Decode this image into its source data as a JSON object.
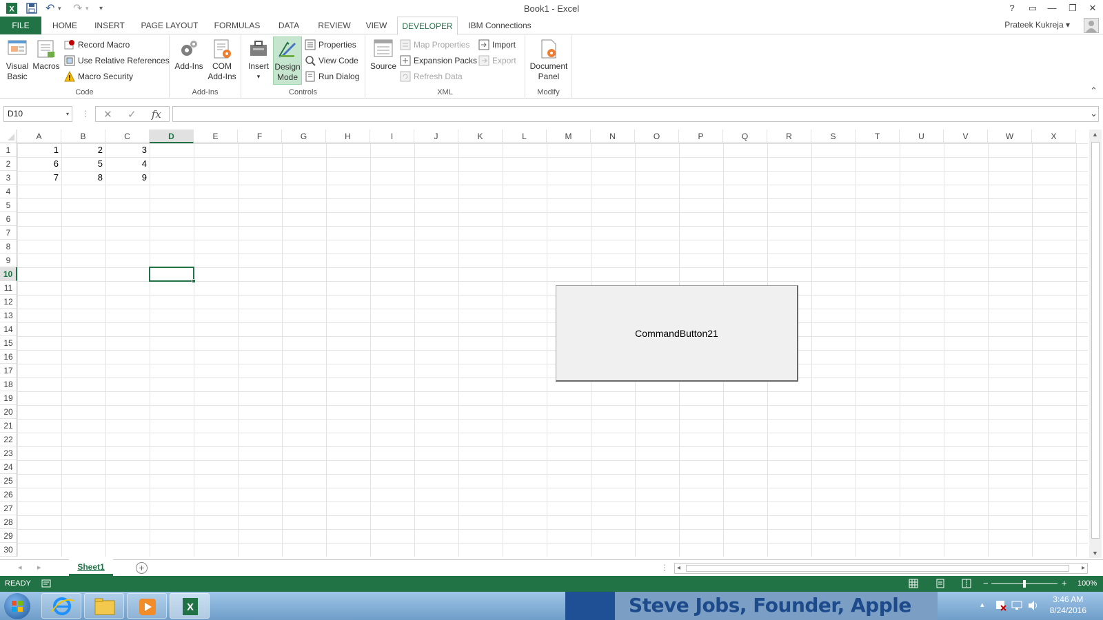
{
  "window": {
    "title": "Book1 - Excel",
    "help": "?",
    "ribbon_display": "▭",
    "minimize": "—",
    "restore": "❐",
    "close": "✕"
  },
  "quick_access": {
    "undo": "↶",
    "redo": "↷",
    "customize": "▾"
  },
  "tabs": [
    {
      "label": "FILE"
    },
    {
      "label": "HOME"
    },
    {
      "label": "INSERT"
    },
    {
      "label": "PAGE LAYOUT"
    },
    {
      "label": "FORMULAS"
    },
    {
      "label": "DATA"
    },
    {
      "label": "REVIEW"
    },
    {
      "label": "VIEW"
    },
    {
      "label": "DEVELOPER"
    },
    {
      "label": "IBM Connections"
    }
  ],
  "user": {
    "name": "Prateek Kukreja",
    "arrow": "▾"
  },
  "ribbon": {
    "code": {
      "label": "Code",
      "visual_basic_1": "Visual",
      "visual_basic_2": "Basic",
      "macros": "Macros",
      "record_macro": "Record Macro",
      "use_relative": "Use Relative References",
      "macro_security": "Macro Security"
    },
    "addins": {
      "label": "Add-Ins",
      "add_ins": "Add-Ins",
      "com_1": "COM",
      "com_2": "Add-Ins"
    },
    "controls": {
      "label": "Controls",
      "insert": "Insert",
      "insert_arrow": "▾",
      "design_1": "Design",
      "design_2": "Mode",
      "properties": "Properties",
      "view_code": "View Code",
      "run_dialog": "Run Dialog"
    },
    "xml": {
      "label": "XML",
      "source": "Source",
      "map_properties": "Map Properties",
      "expansion_packs": "Expansion Packs",
      "refresh_data": "Refresh Data",
      "import": "Import",
      "export": "Export"
    },
    "modify": {
      "label": "Modify",
      "doc_1": "Document",
      "doc_2": "Panel"
    },
    "collapse": "⌃"
  },
  "formula_bar": {
    "name_box": "D10",
    "name_box_arrow": "▾",
    "dots": "⋮",
    "cancel": "✕",
    "enter": "✓",
    "fx": "fx",
    "value": "",
    "expand": "⌄"
  },
  "columns": [
    "A",
    "B",
    "C",
    "D",
    "E",
    "F",
    "G",
    "H",
    "I",
    "J",
    "K",
    "L",
    "M",
    "N",
    "O",
    "P",
    "Q",
    "R",
    "S",
    "T",
    "U",
    "V",
    "W",
    "X"
  ],
  "rows": [
    "1",
    "2",
    "3",
    "4",
    "5",
    "6",
    "7",
    "8",
    "9",
    "10",
    "11",
    "12",
    "13",
    "14",
    "15",
    "16",
    "17",
    "18",
    "19",
    "20",
    "21",
    "22",
    "23",
    "24",
    "25",
    "26",
    "27",
    "28",
    "29",
    "30"
  ],
  "cells": [
    [
      "1",
      "2",
      "3"
    ],
    [
      "6",
      "5",
      "4"
    ],
    [
      "7",
      "8",
      "9"
    ]
  ],
  "selected_cell": {
    "column": "D",
    "row": "10"
  },
  "command_button": {
    "label": "CommandButton21"
  },
  "sheets": {
    "active": "Sheet1",
    "add": "+",
    "prev": "◂",
    "next": "▸",
    "scroll_left": "◂",
    "scroll_right": "▸",
    "dots": "⋮"
  },
  "status": {
    "ready": "READY",
    "zoom": "100%",
    "zoom_minus": "−",
    "zoom_plus": "+",
    "zoom_level": 1.0
  },
  "taskbar": {
    "wallpaper_text": "Steve Jobs, Founder, Apple",
    "time": "3:46 AM",
    "date": "8/24/2016",
    "tray_arrow": "▴"
  },
  "colors": {
    "excel_green": "#217346",
    "design_mode_highlight": "#c6e5ce",
    "taskbar": "#6f9ec9"
  }
}
